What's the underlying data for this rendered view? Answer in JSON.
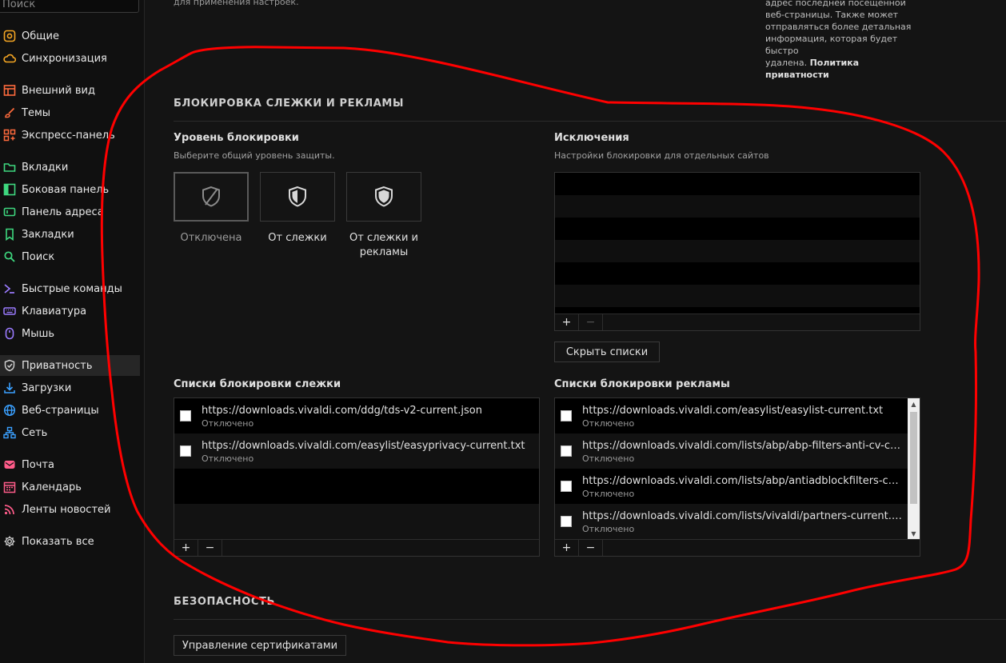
{
  "sidebar": {
    "search_placeholder": "Поиск",
    "items": [
      {
        "label": "Общие",
        "icon": "general-icon",
        "color": "#f5a623"
      },
      {
        "label": "Синхронизация",
        "icon": "cloud-icon",
        "color": "#f5a623"
      },
      {
        "label": "Внешний вид",
        "icon": "appearance-icon",
        "color": "#ff6b3d"
      },
      {
        "label": "Темы",
        "icon": "brush-icon",
        "color": "#ff6b3d"
      },
      {
        "label": "Экспресс-панель",
        "icon": "speed-dial-icon",
        "color": "#ff6b3d"
      },
      {
        "label": "Вкладки",
        "icon": "tabs-icon",
        "color": "#3ed87f"
      },
      {
        "label": "Боковая панель",
        "icon": "panel-icon",
        "color": "#3ed87f"
      },
      {
        "label": "Панель адреса",
        "icon": "address-bar-icon",
        "color": "#3ed87f"
      },
      {
        "label": "Закладки",
        "icon": "bookmark-icon",
        "color": "#3ed87f"
      },
      {
        "label": "Поиск",
        "icon": "search-icon",
        "color": "#3ed87f"
      },
      {
        "label": "Быстрые команды",
        "icon": "quick-commands-icon",
        "color": "#9b7bff"
      },
      {
        "label": "Клавиатура",
        "icon": "keyboard-icon",
        "color": "#9b7bff"
      },
      {
        "label": "Мышь",
        "icon": "mouse-icon",
        "color": "#9b7bff"
      },
      {
        "label": "Приватность",
        "icon": "shield-icon",
        "color": "#cfcfcf"
      },
      {
        "label": "Загрузки",
        "icon": "download-icon",
        "color": "#3aa0ff"
      },
      {
        "label": "Веб-страницы",
        "icon": "globe-icon",
        "color": "#3aa0ff"
      },
      {
        "label": "Сеть",
        "icon": "network-icon",
        "color": "#3aa0ff"
      },
      {
        "label": "Почта",
        "icon": "mail-icon",
        "color": "#ff5c8a"
      },
      {
        "label": "Календарь",
        "icon": "calendar-icon",
        "color": "#ff5c8a"
      },
      {
        "label": "Ленты новостей",
        "icon": "feed-icon",
        "color": "#ff5c8a"
      },
      {
        "label": "Показать все",
        "icon": "gear-icon",
        "color": "#cfcfcf"
      }
    ],
    "active_index": 13
  },
  "top_note": "для применения настроек.",
  "privacy_note": {
    "lines": [
      "адрес последней посещённой",
      "веб-страницы. Также может",
      "отправляться более детальная",
      "информация, которая будет быстро"
    ],
    "last_prefix": "удалена.",
    "link": "Политика приватности"
  },
  "tracker_section": {
    "title": "БЛОКИРОВКА СЛЕЖКИ И РЕКЛАМЫ",
    "level": {
      "title": "Уровень блокировки",
      "desc": "Выберите общий уровень защиты.",
      "options": [
        {
          "label": "Отключена",
          "icon": "shield-off-icon"
        },
        {
          "label": "От слежки",
          "icon": "shield-half-icon"
        },
        {
          "label": "От слежки и рекламы",
          "icon": "shield-full-icon"
        }
      ],
      "selected_index": 0
    },
    "exceptions": {
      "title": "Исключения",
      "desc": "Настройки блокировки для отдельных сайтов",
      "add": "+",
      "remove": "−",
      "hide_lists_button": "Скрыть списки"
    },
    "tracker_lists": {
      "title": "Списки блокировки слежки",
      "items": [
        {
          "url": "https://downloads.vivaldi.com/ddg/tds-v2-current.json",
          "status": "Отключено",
          "checked": false
        },
        {
          "url": "https://downloads.vivaldi.com/easylist/easyprivacy-current.txt",
          "status": "Отключено",
          "checked": false
        }
      ],
      "add": "+",
      "remove": "−"
    },
    "ad_lists": {
      "title": "Списки блокировки рекламы",
      "items": [
        {
          "url": "https://downloads.vivaldi.com/easylist/easylist-current.txt",
          "status": "Отключено",
          "checked": false
        },
        {
          "url": "https://downloads.vivaldi.com/lists/abp/abp-filters-anti-cv-curr...",
          "status": "Отключено",
          "checked": false
        },
        {
          "url": "https://downloads.vivaldi.com/lists/abp/antiadblockfilters-curr...",
          "status": "Отключено",
          "checked": false
        },
        {
          "url": "https://downloads.vivaldi.com/lists/vivaldi/partners-current.txt",
          "status": "Отключено",
          "checked": false
        }
      ],
      "add": "+",
      "remove": "−"
    }
  },
  "security_section": {
    "title": "БЕЗОПАСНОСТЬ",
    "cert_button": "Управление сертификатами"
  },
  "colors": {
    "annotation": "#ff0000",
    "background": "#141414"
  }
}
